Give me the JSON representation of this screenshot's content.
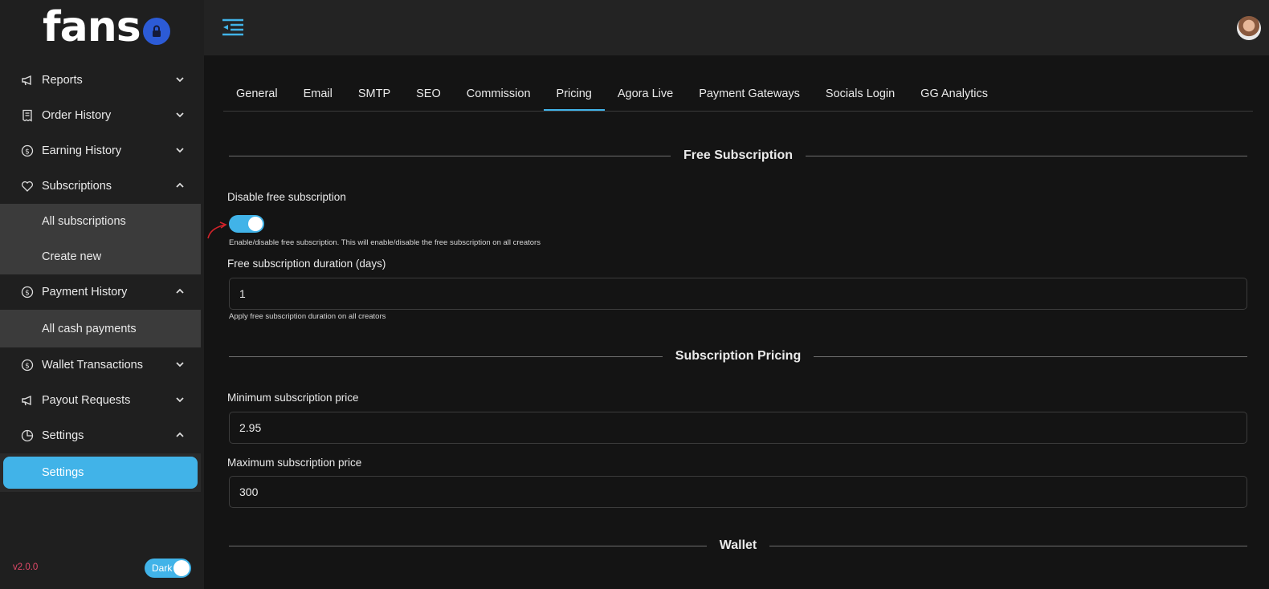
{
  "brand": {
    "logo_text": "fans",
    "logo_icon": "lock-icon"
  },
  "topbar": {
    "menu_icon": "menu-collapse-icon",
    "avatar": "user-avatar"
  },
  "sidebar": {
    "items": [
      {
        "label": "Reports",
        "icon": "megaphone-icon",
        "chevron": "down"
      },
      {
        "label": "Order History",
        "icon": "receipt-icon",
        "chevron": "down"
      },
      {
        "label": "Earning History",
        "icon": "dollar-circle-icon",
        "chevron": "down"
      },
      {
        "label": "Subscriptions",
        "icon": "heart-icon",
        "chevron": "up",
        "children": [
          "All subscriptions",
          "Create new"
        ]
      },
      {
        "label": "Payment History",
        "icon": "dollar-circle-icon",
        "chevron": "up",
        "children": [
          "All cash payments"
        ]
      },
      {
        "label": "Wallet Transactions",
        "icon": "dollar-circle-icon",
        "chevron": "down"
      },
      {
        "label": "Payout Requests",
        "icon": "megaphone-icon",
        "chevron": "down"
      },
      {
        "label": "Settings",
        "icon": "pie-chart-icon",
        "chevron": "up",
        "children": [
          "Settings"
        ],
        "active_child": "Settings"
      }
    ],
    "version": "v2.0.0",
    "theme_label": "Dark",
    "theme_on": true
  },
  "tabs": [
    "General",
    "Email",
    "SMTP",
    "SEO",
    "Commission",
    "Pricing",
    "Agora Live",
    "Payment Gateways",
    "Socials Login",
    "GG Analytics"
  ],
  "active_tab": "Pricing",
  "sections": {
    "free_subscription": {
      "title": "Free Subscription",
      "toggle_label": "Disable free subscription",
      "toggle_on": true,
      "toggle_help": "Enable/disable free subscription. This will enable/disable the free subscription on all creators",
      "duration_label": "Free subscription duration (days)",
      "duration_value": "1",
      "duration_help": "Apply free subscription duration on all creators"
    },
    "subscription_pricing": {
      "title": "Subscription Pricing",
      "min_label": "Minimum subscription price",
      "min_value": "2.95",
      "max_label": "Maximum subscription price",
      "max_value": "300"
    },
    "wallet": {
      "title": "Wallet"
    }
  },
  "colors": {
    "accent": "#41b3e8",
    "version": "#e34a6a",
    "annotation_arrow": "#d2232a"
  }
}
